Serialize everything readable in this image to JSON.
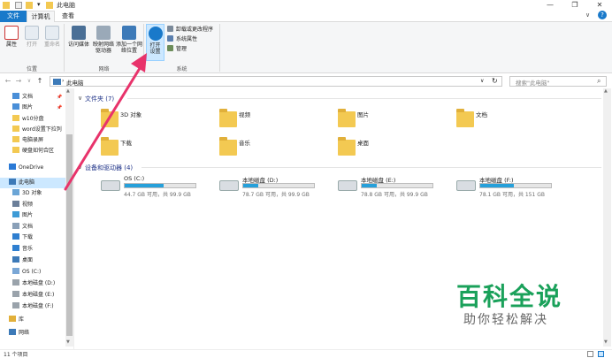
{
  "window": {
    "title": "此电脑",
    "controls": [
      "—",
      "❐",
      "✕"
    ],
    "help": "?"
  },
  "ribbon_tabs": [
    {
      "label": "文件",
      "active": false
    },
    {
      "label": "计算机",
      "active": true
    },
    {
      "label": "查看",
      "active": false
    }
  ],
  "ribbon": {
    "location_group": {
      "label": "位置",
      "buttons": [
        "属性",
        "打开",
        "重命名"
      ]
    },
    "network_group": {
      "label": "网络",
      "buttons": [
        "访问媒体",
        "映射网络驱动器",
        "添加一个网络位置"
      ]
    },
    "system_group": {
      "label": "系统",
      "open_settings": "打开设置",
      "items": [
        "卸载或更改程序",
        "系统属性",
        "管理"
      ]
    }
  },
  "address": {
    "path": "此电脑",
    "search_placeholder": "搜索\"此电脑\""
  },
  "sidebar": {
    "items": [
      {
        "label": "文档",
        "pinned": true
      },
      {
        "label": "图片",
        "pinned": true
      },
      {
        "label": "w10分盘"
      },
      {
        "label": "word设置下拉列"
      },
      {
        "label": "电脑录屏"
      },
      {
        "label": "硬盘如何合区"
      },
      {
        "label": "OneDrive"
      },
      {
        "label": "此电脑",
        "selected": true
      },
      {
        "label": "3D 对象"
      },
      {
        "label": "视频"
      },
      {
        "label": "图片"
      },
      {
        "label": "文档"
      },
      {
        "label": "下载"
      },
      {
        "label": "音乐"
      },
      {
        "label": "桌面"
      },
      {
        "label": "OS (C:)"
      },
      {
        "label": "本地磁盘 (D:)"
      },
      {
        "label": "本地磁盘 (E:)"
      },
      {
        "label": "本地磁盘 (F:)"
      },
      {
        "label": "库"
      },
      {
        "label": "网络"
      }
    ]
  },
  "content": {
    "folders_title": "文件夹 (7)",
    "folders": [
      "3D 对象",
      "视频",
      "图片",
      "文档",
      "下载",
      "音乐",
      "桌面"
    ],
    "drives_title": "设备和驱动器 (4)",
    "drives": [
      {
        "name": "OS (C:)",
        "detail": "44.7 GB 可用，共 99.9 GB",
        "used_fraction": 0.55
      },
      {
        "name": "本地磁盘 (D:)",
        "detail": "78.7 GB 可用，共 99.9 GB",
        "used_fraction": 0.21
      },
      {
        "name": "本地磁盘 (E:)",
        "detail": "78.8 GB 可用，共 99.9 GB",
        "used_fraction": 0.21
      },
      {
        "name": "本地磁盘 (F:)",
        "detail": "78.1 GB 可用，共 151 GB",
        "used_fraction": 0.48
      }
    ]
  },
  "status": "11 个项目",
  "watermark": {
    "main": "百科全说",
    "sub": "助你轻松解决"
  },
  "colors": {
    "accent": "#1979ca",
    "drive_fill": "#26a0da",
    "arrow": "#e8336b",
    "watermark": "#1aa15a"
  }
}
